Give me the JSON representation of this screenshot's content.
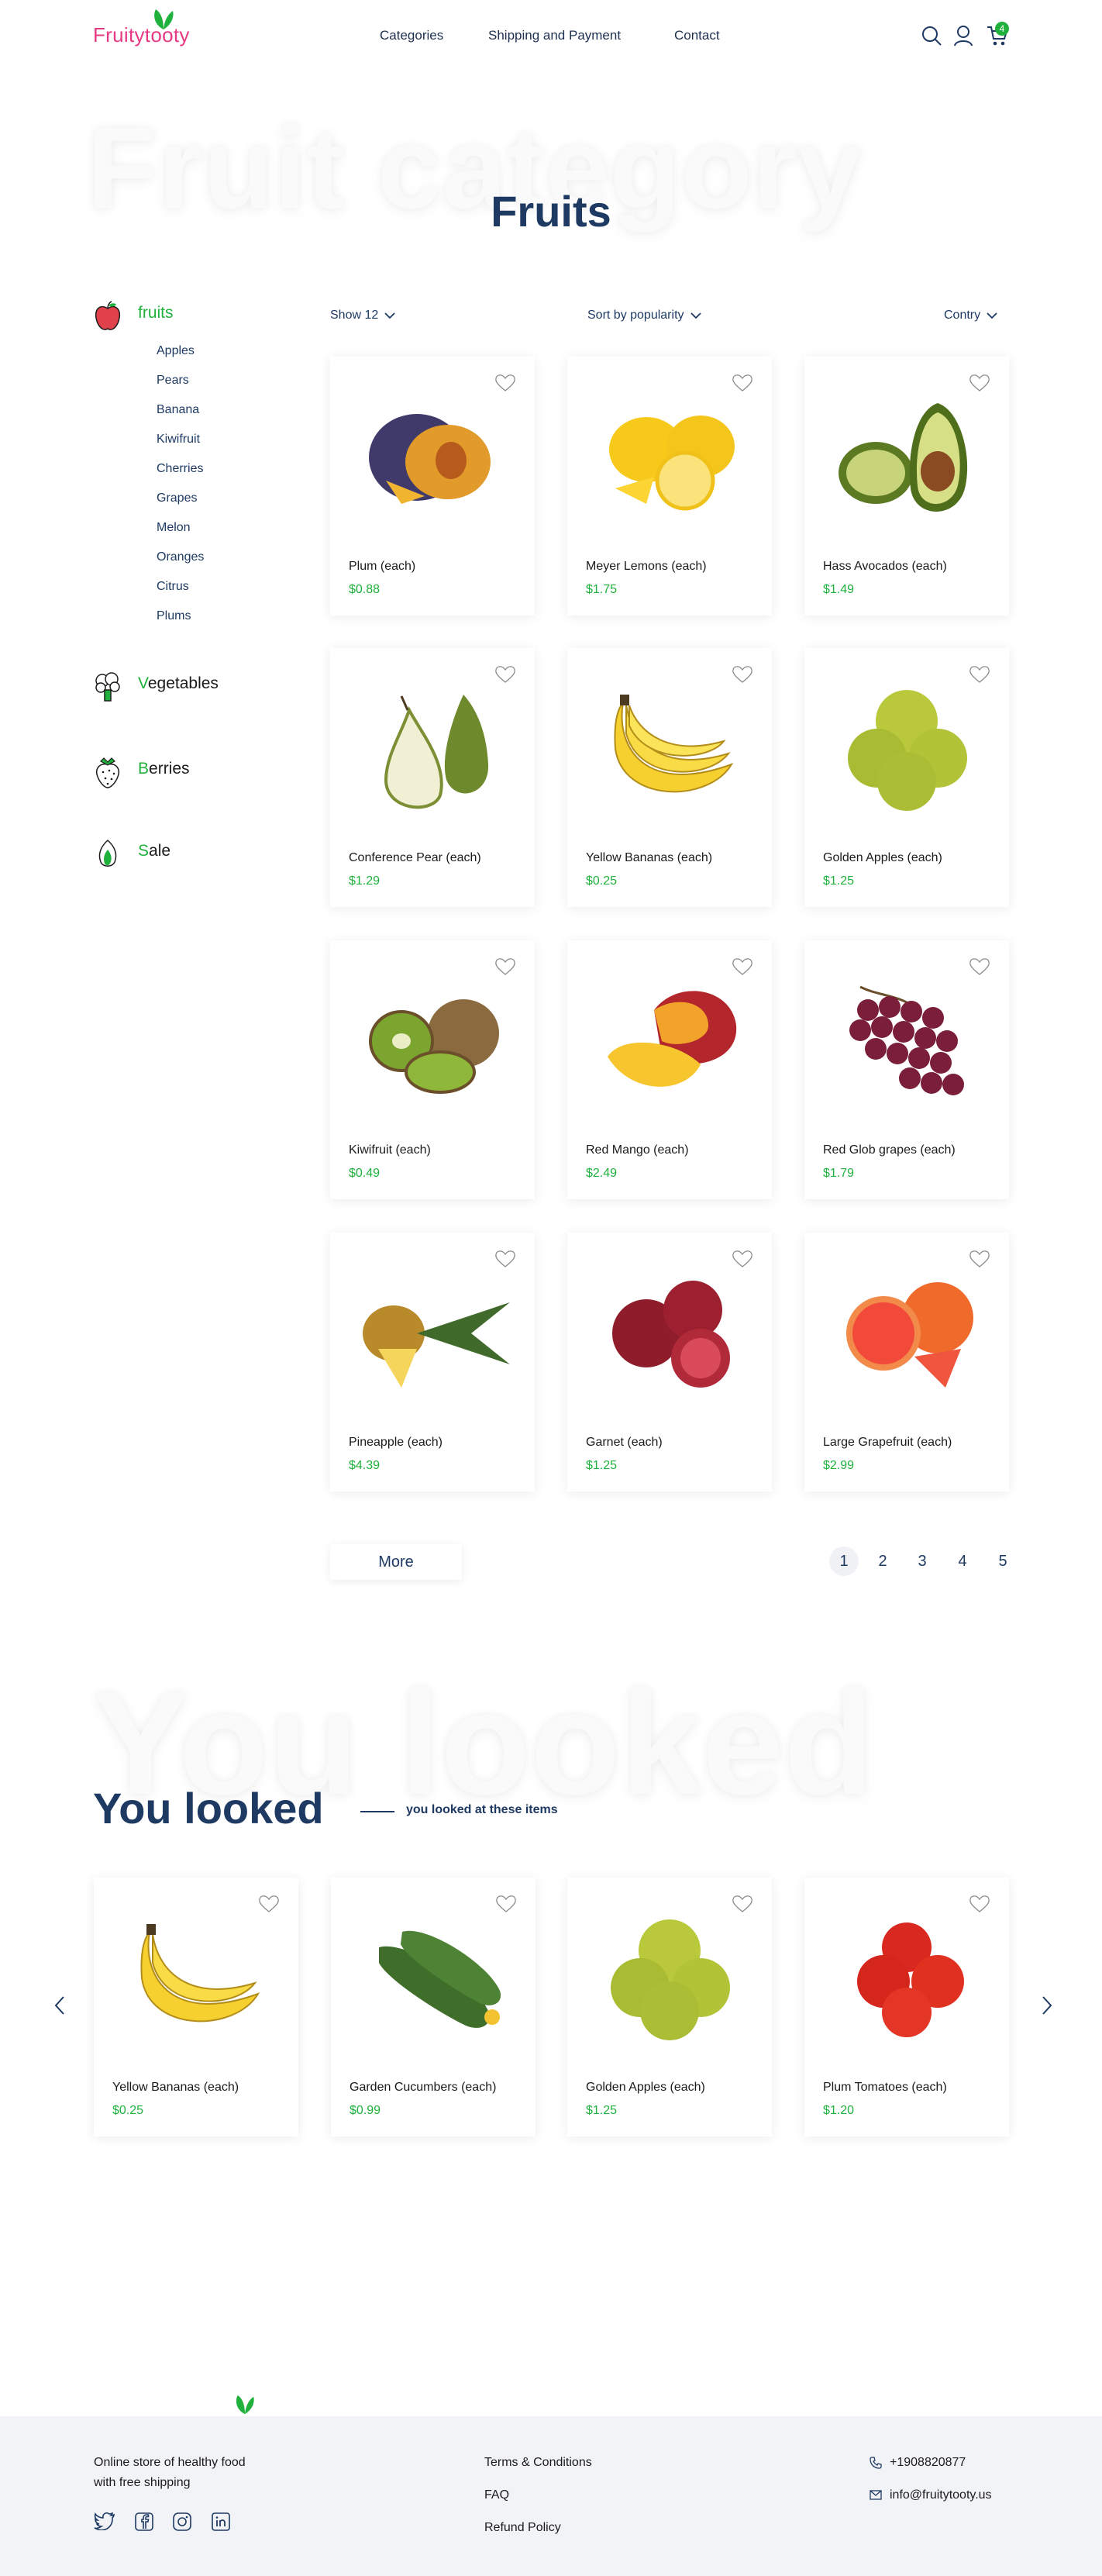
{
  "brand": {
    "logo_text": "Fruitytooty",
    "logo_color": "#e73a84",
    "accent_green": "#1fb13c",
    "navy": "#1e3a63"
  },
  "nav": [
    "Categories",
    "Shipping and Payment",
    "Contact"
  ],
  "header_icons": {
    "search": "search-icon",
    "user": "user-icon",
    "cart": "cart-icon",
    "cart_count": "4"
  },
  "hero": {
    "ghost_text": "Fruit category",
    "title": "Fruits"
  },
  "sidebar": {
    "categories": [
      {
        "label_first": "",
        "label_rest": "fruits",
        "icon": "apple-icon",
        "active": true
      },
      {
        "label_first": "V",
        "label_rest": "egetables",
        "icon": "broccoli-icon"
      },
      {
        "label_first": "B",
        "label_rest": "erries",
        "icon": "strawberry-icon"
      },
      {
        "label_first": "S",
        "label_rest": "ale",
        "icon": "sale-icon"
      }
    ],
    "subcategories": [
      "Apples",
      "Pears",
      "Banana",
      "Kiwifruit",
      "Cherries",
      "Grapes",
      "Melon",
      "Oranges",
      "Citrus",
      "Plums"
    ]
  },
  "filters": {
    "show": "Show 12",
    "sort": "Sort by popularity",
    "country": "Contry"
  },
  "products": [
    {
      "name": "Plum (each)",
      "price": "$0.88",
      "image": "plum-image"
    },
    {
      "name": "Meyer Lemons (each)",
      "price": "$1.75",
      "image": "lemon-image"
    },
    {
      "name": "Hass Avocados (each)",
      "price": "$1.49",
      "image": "avocado-image"
    },
    {
      "name": "Conference Pear (each)",
      "price": "$1.29",
      "image": "pear-image"
    },
    {
      "name": "Yellow Bananas (each)",
      "price": "$0.25",
      "image": "banana-image"
    },
    {
      "name": "Golden Apples (each)",
      "price": "$1.25",
      "image": "apple-image"
    },
    {
      "name": "Kiwifruit (each)",
      "price": "$0.49",
      "image": "kiwi-image"
    },
    {
      "name": "Red Mango (each)",
      "price": "$2.49",
      "image": "mango-image"
    },
    {
      "name": "Red Glob grapes (each)",
      "price": "$1.79",
      "image": "grapes-image"
    },
    {
      "name": "Pineapple (each)",
      "price": "$4.39",
      "image": "pineapple-image"
    },
    {
      "name": "Garnet (each)",
      "price": "$1.25",
      "image": "pomegranate-image"
    },
    {
      "name": "Large Grapefruit (each)",
      "price": "$2.99",
      "image": "grapefruit-image"
    }
  ],
  "more_label": "More",
  "pagination": {
    "pages": [
      "1",
      "2",
      "3",
      "4",
      "5"
    ],
    "current": 1
  },
  "viewed": {
    "ghost_text": "You looked",
    "title": "You looked",
    "subtitle": "you looked at these items",
    "items": [
      {
        "name": "Yellow Bananas (each)",
        "price": "$0.25",
        "image": "banana-image"
      },
      {
        "name": "Garden Cucumbers (each)",
        "price": "$0.99",
        "image": "cucumber-image"
      },
      {
        "name": "Golden Apples (each)",
        "price": "$1.25",
        "image": "apple-image"
      },
      {
        "name": "Plum Tomatoes (each)",
        "price": "$1.20",
        "image": "tomato-image"
      }
    ]
  },
  "footer": {
    "tagline_line1": "Online store of healthy food",
    "tagline_line2": "with free shipping",
    "links": [
      "Terms & Conditions",
      "FAQ",
      "Refund Policy"
    ],
    "phone": "+1908820877",
    "email": "info@fruitytooty.us",
    "social": [
      "twitter-icon",
      "facebook-icon",
      "instagram-icon",
      "linkedin-icon"
    ]
  }
}
